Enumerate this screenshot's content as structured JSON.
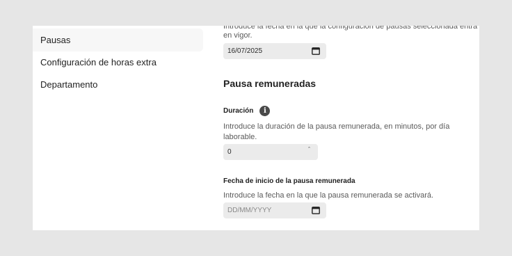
{
  "sidebar": {
    "items": [
      {
        "label": "Pausas"
      },
      {
        "label": "Configuración de horas extra"
      },
      {
        "label": "Departamento"
      }
    ]
  },
  "content": {
    "top_help_line1": "Introduce la fecha en la que la configuración de pausas seleccionada entra",
    "top_help_line2": "en vigor.",
    "effective_date_value": "16/07/2025",
    "section_title": "Pausa remuneradas",
    "duration": {
      "label": "Duración",
      "help_line1": "Introduce la duración de la pausa remunerada, en minutos, por día",
      "help_line2": "laborable.",
      "value": "0"
    },
    "start_date": {
      "label": "Fecha de inicio de la pausa remunerada",
      "help": "Introduce la fecha en la que la pausa remunerada se activará.",
      "placeholder": "DD/MM/YYYY"
    }
  },
  "colors": {
    "page_background": "#e6e6e6",
    "panel_background": "#ffffff",
    "input_background": "#ebebeb"
  },
  "icons": [
    "calendar-icon",
    "info-icon",
    "spinner-up-icon"
  ]
}
